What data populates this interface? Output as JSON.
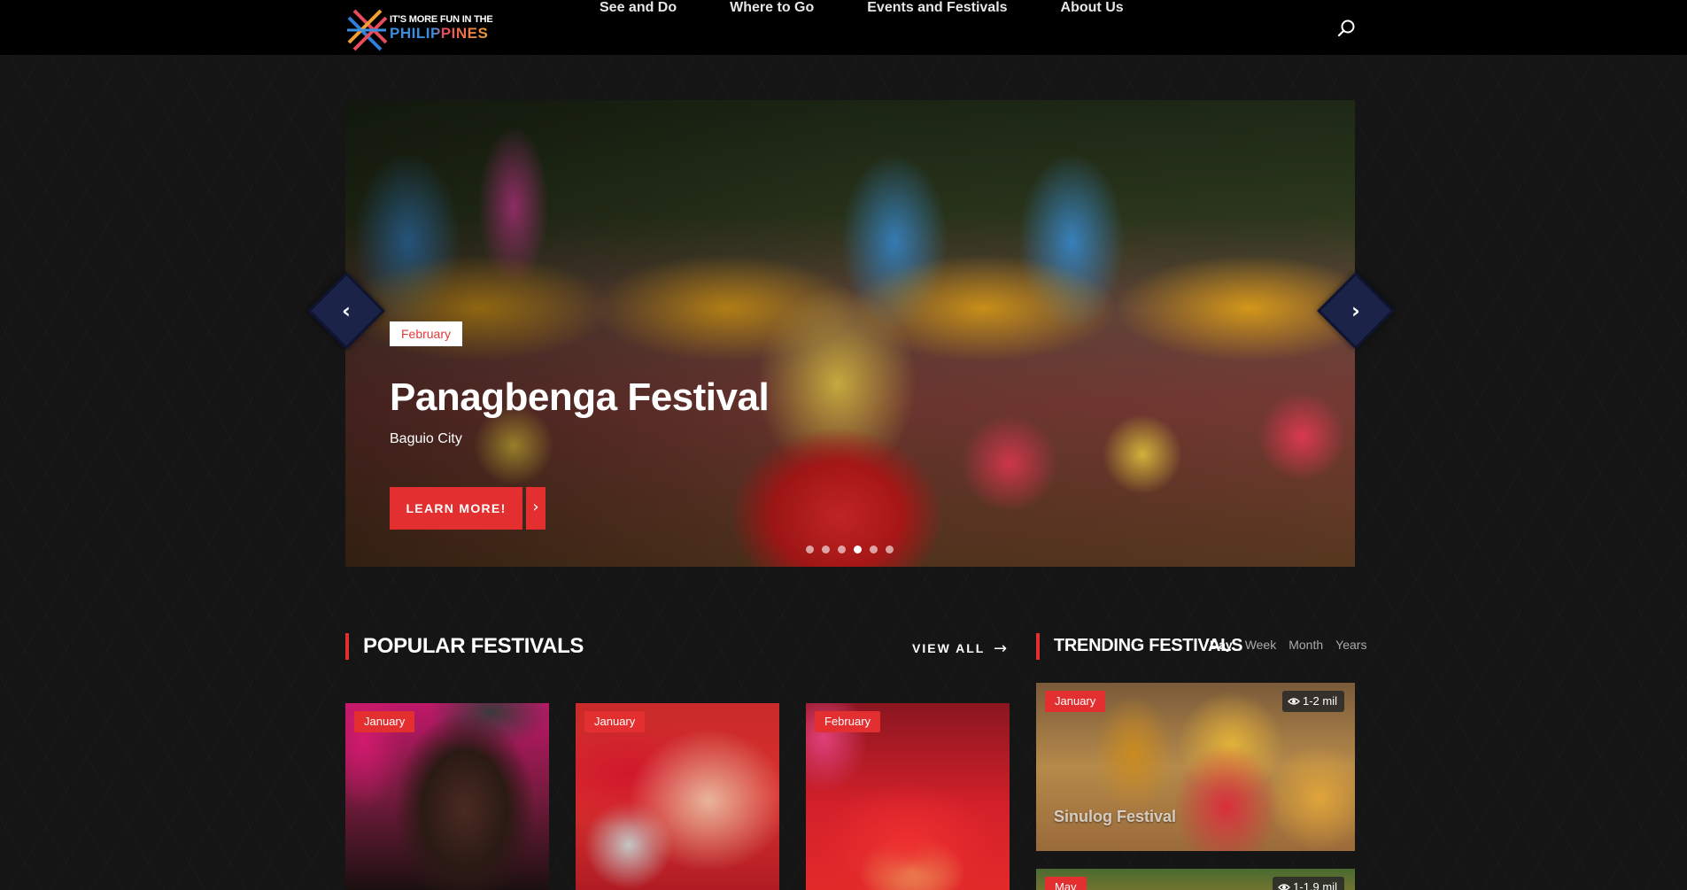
{
  "header": {
    "logo_line1": "IT'S MORE FUN IN THE",
    "logo_line2": "PHILIPPINES",
    "nav": [
      "See and Do",
      "Where to Go",
      "Events and Festivals",
      "About Us"
    ]
  },
  "hero": {
    "month": "February",
    "title": "Panagbenga Festival",
    "location": "Baguio City",
    "button_label": "LEARN MORE!",
    "slide_count": 6,
    "active_slide": 4
  },
  "popular": {
    "title": "POPULAR FESTIVALS",
    "view_all_label": "VIEW ALL",
    "cards": [
      {
        "month": "January"
      },
      {
        "month": "January"
      },
      {
        "month": "February"
      }
    ]
  },
  "trending": {
    "title": "TRENDING FESTIVALS",
    "tabs": [
      "Day",
      "Week",
      "Month",
      "Years"
    ],
    "active_tab": "Day",
    "items": [
      {
        "month": "January",
        "views": "1-2 mil",
        "title": "Sinulog Festival"
      },
      {
        "month": "May",
        "views": "1-1.9 mil",
        "title": ""
      }
    ]
  },
  "colors": {
    "accent": "#e32f2f",
    "header_bg": "#000000",
    "arrow_bg": "#1c2348"
  },
  "icons": {
    "search": "search-icon",
    "prev": "chevron-left-icon",
    "next": "chevron-right-icon",
    "view_all": "arrow-right-icon",
    "views": "eye-icon"
  }
}
